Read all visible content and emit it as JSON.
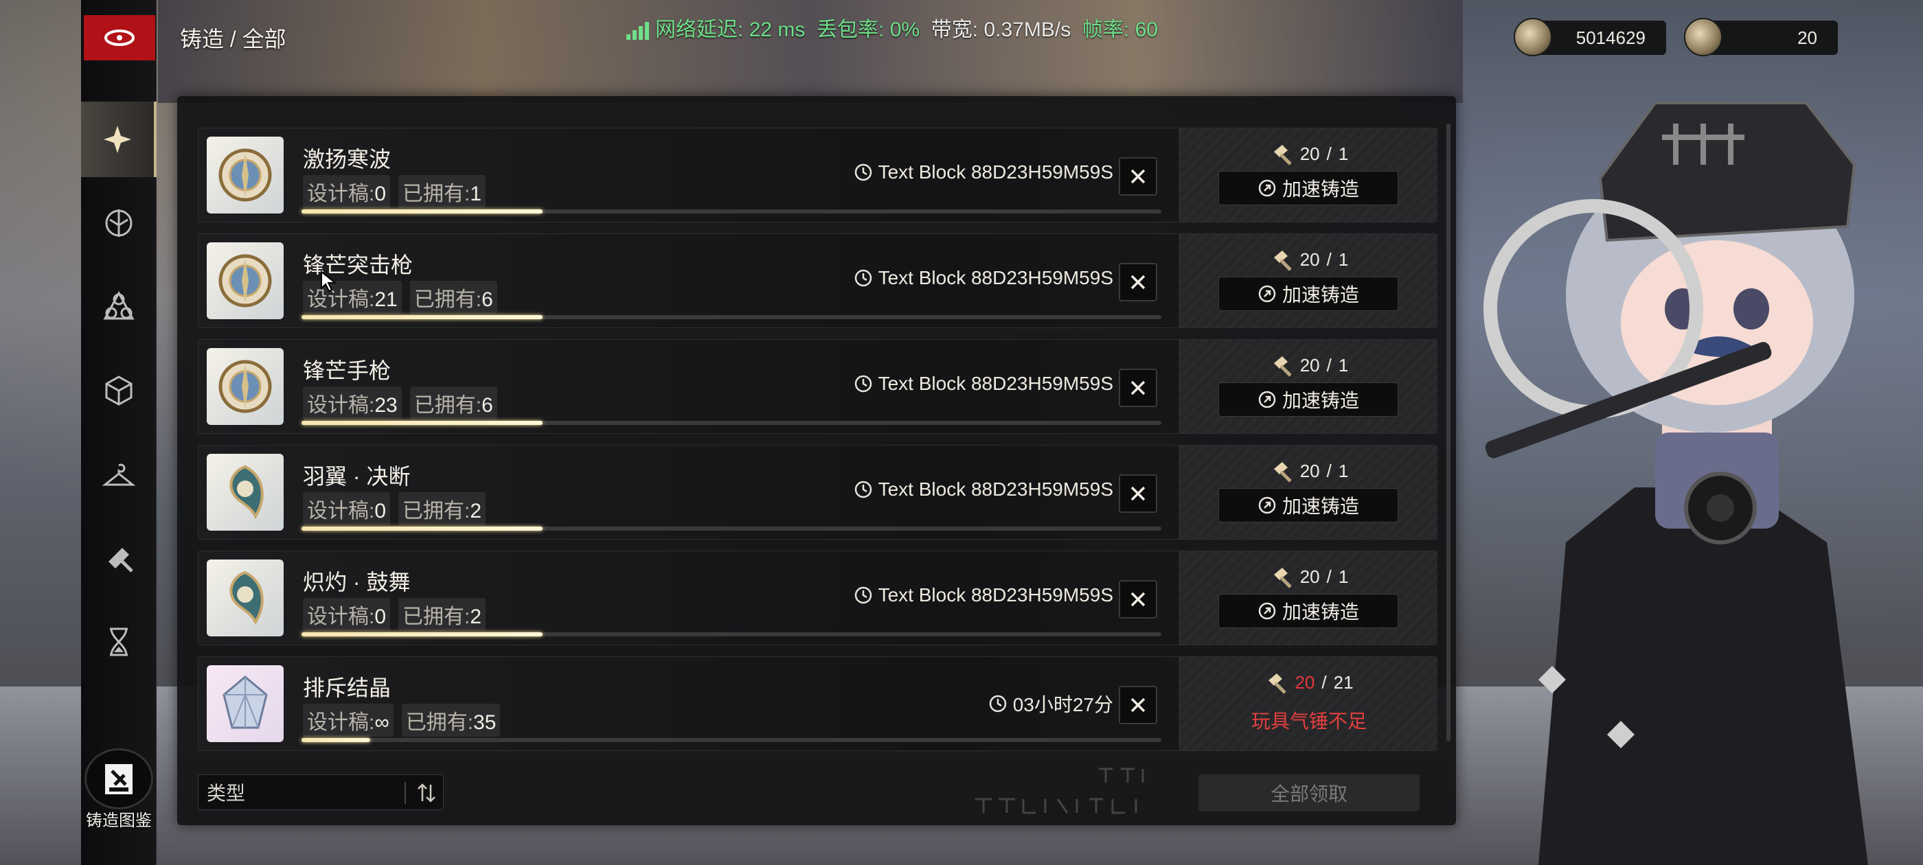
{
  "header": {
    "breadcrumb": "铸造 / 全部",
    "network": {
      "latency_label": "网络延迟:",
      "latency_value": "22 ms",
      "loss_label": "丢包率:",
      "loss_value": "0%",
      "bandwidth_label": "带宽:",
      "bandwidth_value": "0.37MB/s",
      "fps_label": "帧率:",
      "fps_value": "60"
    },
    "currencies": [
      {
        "icon": "coin-icon",
        "value": "5014629"
      },
      {
        "icon": "hammer-token-icon",
        "value": "20"
      }
    ]
  },
  "sidebar": {
    "items": [
      {
        "icon": "all-category-icon",
        "active": true
      },
      {
        "icon": "weapon-icon",
        "active": false
      },
      {
        "icon": "module-icon",
        "active": false
      },
      {
        "icon": "cube-icon",
        "active": false
      },
      {
        "icon": "hanger-icon",
        "active": false
      },
      {
        "icon": "hammer-tool-icon",
        "active": false
      },
      {
        "icon": "hourglass-icon",
        "active": false
      }
    ],
    "codex_label": "铸造图鉴"
  },
  "forge_list": [
    {
      "name": "激扬寒波",
      "design_label": "设计稿:",
      "design_value": "0",
      "owned_label": "已拥有:",
      "owned_value": "1",
      "timer": "Text Block 88D23H59M59S",
      "progress": 0.28,
      "hammer_have": "20",
      "hammer_sep": "/",
      "hammer_need": "1",
      "hammer_enough": true,
      "speed_label": "加速铸造",
      "icon": "compass-emblem"
    },
    {
      "name": "锋芒突击枪",
      "design_label": "设计稿:",
      "design_value": "21",
      "owned_label": "已拥有:",
      "owned_value": "6",
      "timer": "Text Block 88D23H59M59S",
      "progress": 0.28,
      "hammer_have": "20",
      "hammer_sep": "/",
      "hammer_need": "1",
      "hammer_enough": true,
      "speed_label": "加速铸造",
      "icon": "compass-emblem"
    },
    {
      "name": "锋芒手枪",
      "design_label": "设计稿:",
      "design_value": "23",
      "owned_label": "已拥有:",
      "owned_value": "6",
      "timer": "Text Block 88D23H59M59S",
      "progress": 0.28,
      "hammer_have": "20",
      "hammer_sep": "/",
      "hammer_need": "1",
      "hammer_enough": true,
      "speed_label": "加速铸造",
      "icon": "compass-emblem"
    },
    {
      "name": "羽翼 · 决断",
      "design_label": "设计稿:",
      "design_value": "0",
      "owned_label": "已拥有:",
      "owned_value": "2",
      "timer": "Text Block 88D23H59M59S",
      "progress": 0.28,
      "hammer_have": "20",
      "hammer_sep": "/",
      "hammer_need": "1",
      "hammer_enough": true,
      "speed_label": "加速铸造",
      "icon": "wing-emblem"
    },
    {
      "name": "炽灼 · 鼓舞",
      "design_label": "设计稿:",
      "design_value": "0",
      "owned_label": "已拥有:",
      "owned_value": "2",
      "timer": "Text Block 88D23H59M59S",
      "progress": 0.28,
      "hammer_have": "20",
      "hammer_sep": "/",
      "hammer_need": "1",
      "hammer_enough": true,
      "speed_label": "加速铸造",
      "icon": "wing-emblem"
    },
    {
      "name": "排斥结晶",
      "design_label": "设计稿:",
      "design_value": "∞",
      "owned_label": "已拥有:",
      "owned_value": "35",
      "timer": "03小时27分",
      "progress": 0.08,
      "hammer_have": "20",
      "hammer_sep": "/",
      "hammer_need": "21",
      "hammer_enough": false,
      "warning": "玩具气锤不足",
      "icon": "crystal"
    }
  ],
  "footer": {
    "filter_label": "类型",
    "claim_all_label": "全部领取"
  },
  "colors": {
    "accent_red": "#b11217",
    "progress_fill": "#f5e6b0",
    "warning": "#e3403f",
    "latency_green": "#6fe08a"
  }
}
